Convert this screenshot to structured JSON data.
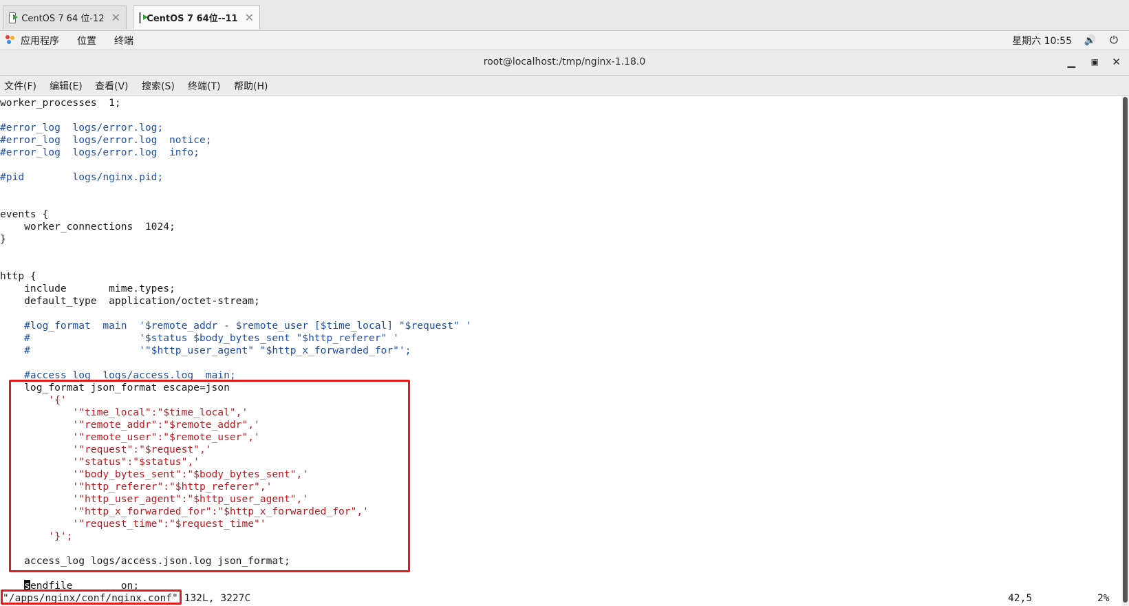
{
  "vm_tabs": [
    {
      "label": "CentOS 7 64 位-12",
      "active": false
    },
    {
      "label": "CentOS 7 64位--11",
      "active": true
    }
  ],
  "top_bar": {
    "menus": [
      "应用程序",
      "位置",
      "终端"
    ],
    "clock": "星期六 10:55"
  },
  "window": {
    "title": "root@localhost:/tmp/nginx-1.18.0",
    "menu": [
      "文件(F)",
      "编辑(E)",
      "查看(V)",
      "搜索(S)",
      "终端(T)",
      "帮助(H)"
    ]
  },
  "editor": {
    "lines": [
      {
        "text": "worker_processes  1;",
        "style": "normal"
      },
      {
        "text": "",
        "style": "normal"
      },
      {
        "text": "#error_log  logs/error.log;",
        "style": "comment"
      },
      {
        "text": "#error_log  logs/error.log  notice;",
        "style": "comment"
      },
      {
        "text": "#error_log  logs/error.log  info;",
        "style": "comment"
      },
      {
        "text": "",
        "style": "normal"
      },
      {
        "text": "#pid        logs/nginx.pid;",
        "style": "comment"
      },
      {
        "text": "",
        "style": "normal"
      },
      {
        "text": "",
        "style": "normal"
      },
      {
        "text": "events {",
        "style": "normal"
      },
      {
        "text": "    worker_connections  1024;",
        "style": "normal"
      },
      {
        "text": "}",
        "style": "normal"
      },
      {
        "text": "",
        "style": "normal"
      },
      {
        "text": "",
        "style": "normal"
      },
      {
        "text": "http {",
        "style": "normal"
      },
      {
        "text": "    include       mime.types;",
        "style": "normal"
      },
      {
        "text": "    default_type  application/octet-stream;",
        "style": "normal"
      },
      {
        "text": "",
        "style": "normal"
      },
      {
        "text": "    #log_format  main  '$remote_addr - $remote_user [$time_local] \"$request\" '",
        "style": "comment"
      },
      {
        "text": "    #                  '$status $body_bytes_sent \"$http_referer\" '",
        "style": "comment"
      },
      {
        "text": "    #                  '\"$http_user_agent\" \"$http_x_forwarded_for\"';",
        "style": "comment"
      },
      {
        "text": "",
        "style": "normal"
      },
      {
        "text": "    #access_log  logs/access.log  main;",
        "style": "comment"
      },
      {
        "text": "    log_format json_format escape=json",
        "style": "normal"
      },
      {
        "text": "        '{'",
        "style": "red"
      },
      {
        "text": "            '\"time_local\":\"$time_local\",'",
        "style": "red"
      },
      {
        "text": "            '\"remote_addr\":\"$remote_addr\",'",
        "style": "red"
      },
      {
        "text": "            '\"remote_user\":\"$remote_user\",'",
        "style": "red"
      },
      {
        "text": "            '\"request\":\"$request\",'",
        "style": "red"
      },
      {
        "text": "            '\"status\":\"$status\",'",
        "style": "red"
      },
      {
        "text": "            '\"body_bytes_sent\":\"$body_bytes_sent\",'",
        "style": "red"
      },
      {
        "text": "            '\"http_referer\":\"$http_referer\",'",
        "style": "red"
      },
      {
        "text": "            '\"http_user_agent\":\"$http_user_agent\",'",
        "style": "red"
      },
      {
        "text": "            '\"http_x_forwarded_for\":\"$http_x_forwarded_for\",'",
        "style": "red"
      },
      {
        "text": "            '\"request_time\":\"$request_time\"'",
        "style": "red"
      },
      {
        "text": "        '}';",
        "style": "red"
      },
      {
        "text": "",
        "style": "normal"
      },
      {
        "text": "    access_log logs/access.json.log json_format;",
        "style": "normal"
      },
      {
        "text": "",
        "style": "normal"
      }
    ],
    "cursor_line": {
      "indent": "    ",
      "cursor_char": "s",
      "rest": "endfile        on;"
    },
    "status": {
      "filename": "\"/apps/nginx/conf/nginx.conf\"",
      "info": " 132L, 3227C",
      "position": "42,5",
      "percent": "2%"
    }
  },
  "colors": {
    "comment": "#1f4fa8",
    "string_red": "#c4161c",
    "highlight_box": "#e21a1a"
  }
}
